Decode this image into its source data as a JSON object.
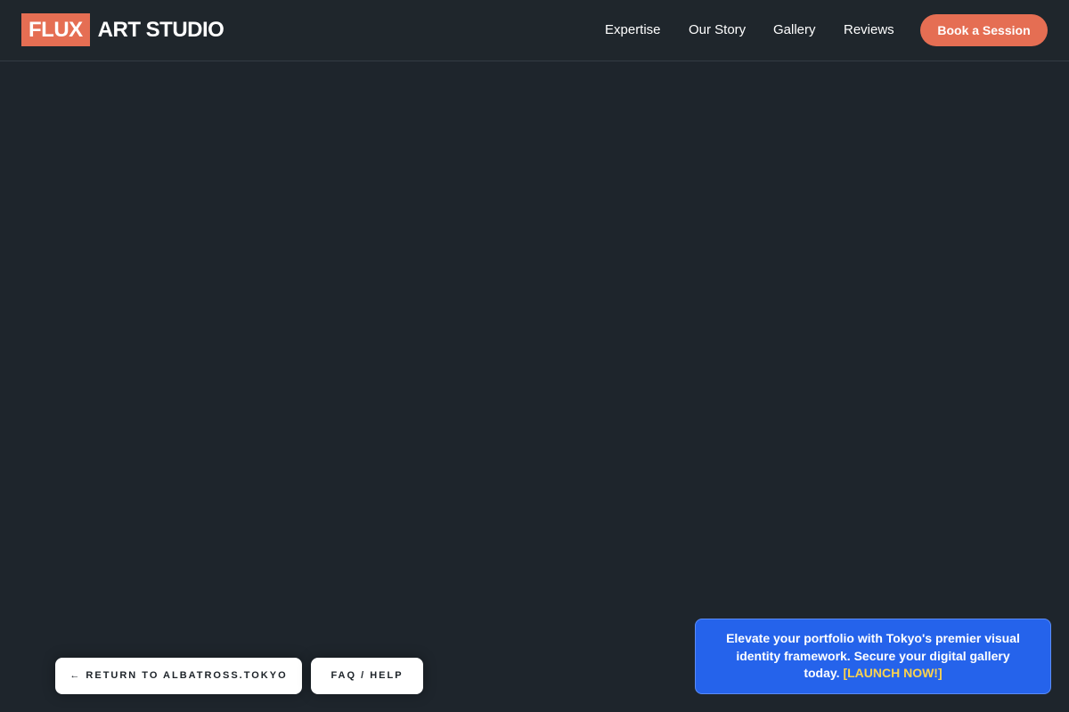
{
  "header": {
    "logo_mark": "FLUX",
    "logo_text": "ART STUDIO",
    "nav": [
      {
        "label": "Expertise"
      },
      {
        "label": "Our Story"
      },
      {
        "label": "Gallery"
      },
      {
        "label": "Reviews"
      }
    ],
    "cta_label": "Book a Session"
  },
  "footer_buttons": {
    "return_label": "← RETURN TO ALBATROSS.TOKYO",
    "faq_label": "FAQ / HELP"
  },
  "promo": {
    "text": "Elevate your portfolio with Tokyo's premier visual identity framework. Secure your digital gallery today.",
    "link_label": "[LAUNCH NOW!]"
  },
  "colors": {
    "background": "#1e252c",
    "accent": "#e56e53",
    "promo_bg": "#2563eb",
    "promo_link": "#fcd34d"
  }
}
